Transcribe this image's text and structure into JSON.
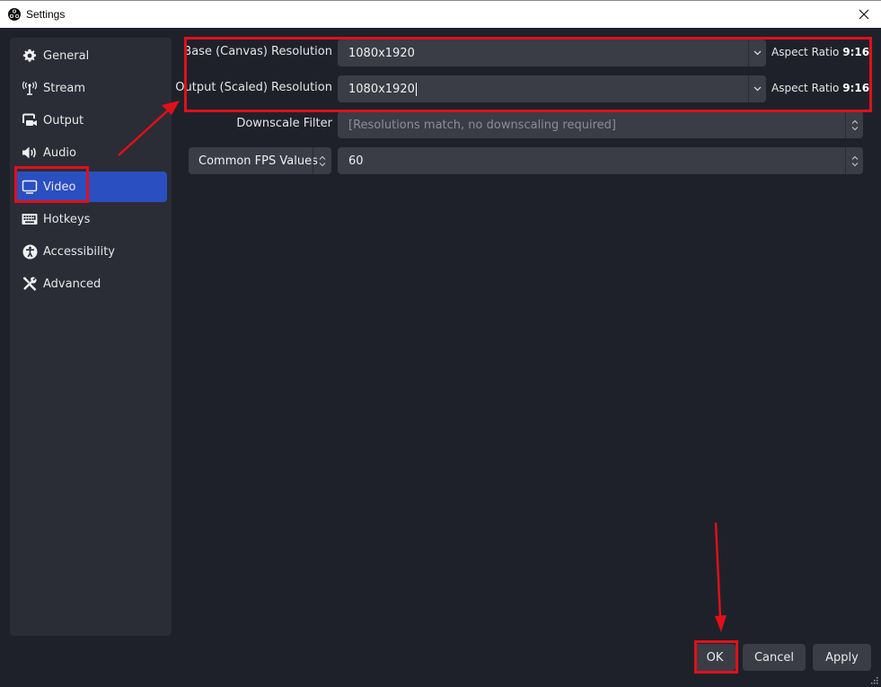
{
  "window": {
    "title": "Settings",
    "app_icon": "obs-logo-icon",
    "close_icon": "close-icon"
  },
  "sidebar": {
    "items": [
      {
        "label": "General",
        "icon": "gear-icon",
        "active": false
      },
      {
        "label": "Stream",
        "icon": "antenna-icon",
        "active": false
      },
      {
        "label": "Output",
        "icon": "output-icon",
        "active": false
      },
      {
        "label": "Audio",
        "icon": "speaker-icon",
        "active": false
      },
      {
        "label": "Video",
        "icon": "monitor-icon",
        "active": true
      },
      {
        "label": "Hotkeys",
        "icon": "keyboard-icon",
        "active": false
      },
      {
        "label": "Accessibility",
        "icon": "accessibility-icon",
        "active": false
      },
      {
        "label": "Advanced",
        "icon": "tools-icon",
        "active": false
      }
    ]
  },
  "video": {
    "base_resolution": {
      "label": "Base (Canvas) Resolution",
      "value": "1080x1920",
      "aspect_label": "Aspect Ratio",
      "aspect_value": "9:16"
    },
    "output_resolution": {
      "label": "Output (Scaled) Resolution",
      "value": "1080x1920",
      "aspect_label": "Aspect Ratio",
      "aspect_value": "9:16"
    },
    "downscale_filter": {
      "label": "Downscale Filter",
      "value": "[Resolutions match, no downscaling required]"
    },
    "fps": {
      "type_value": "Common FPS Values",
      "value": "60"
    }
  },
  "buttons": {
    "ok": "OK",
    "cancel": "Cancel",
    "apply": "Apply"
  },
  "annotations": {
    "color": "#e0101a",
    "highlighted": [
      "resolution-settings-group",
      "sidebar-item-video",
      "ok-button"
    ]
  },
  "colors": {
    "background": "#1f212a",
    "panel": "#2a2c36",
    "control": "#3a3c46",
    "accent": "#2a4fc0"
  }
}
